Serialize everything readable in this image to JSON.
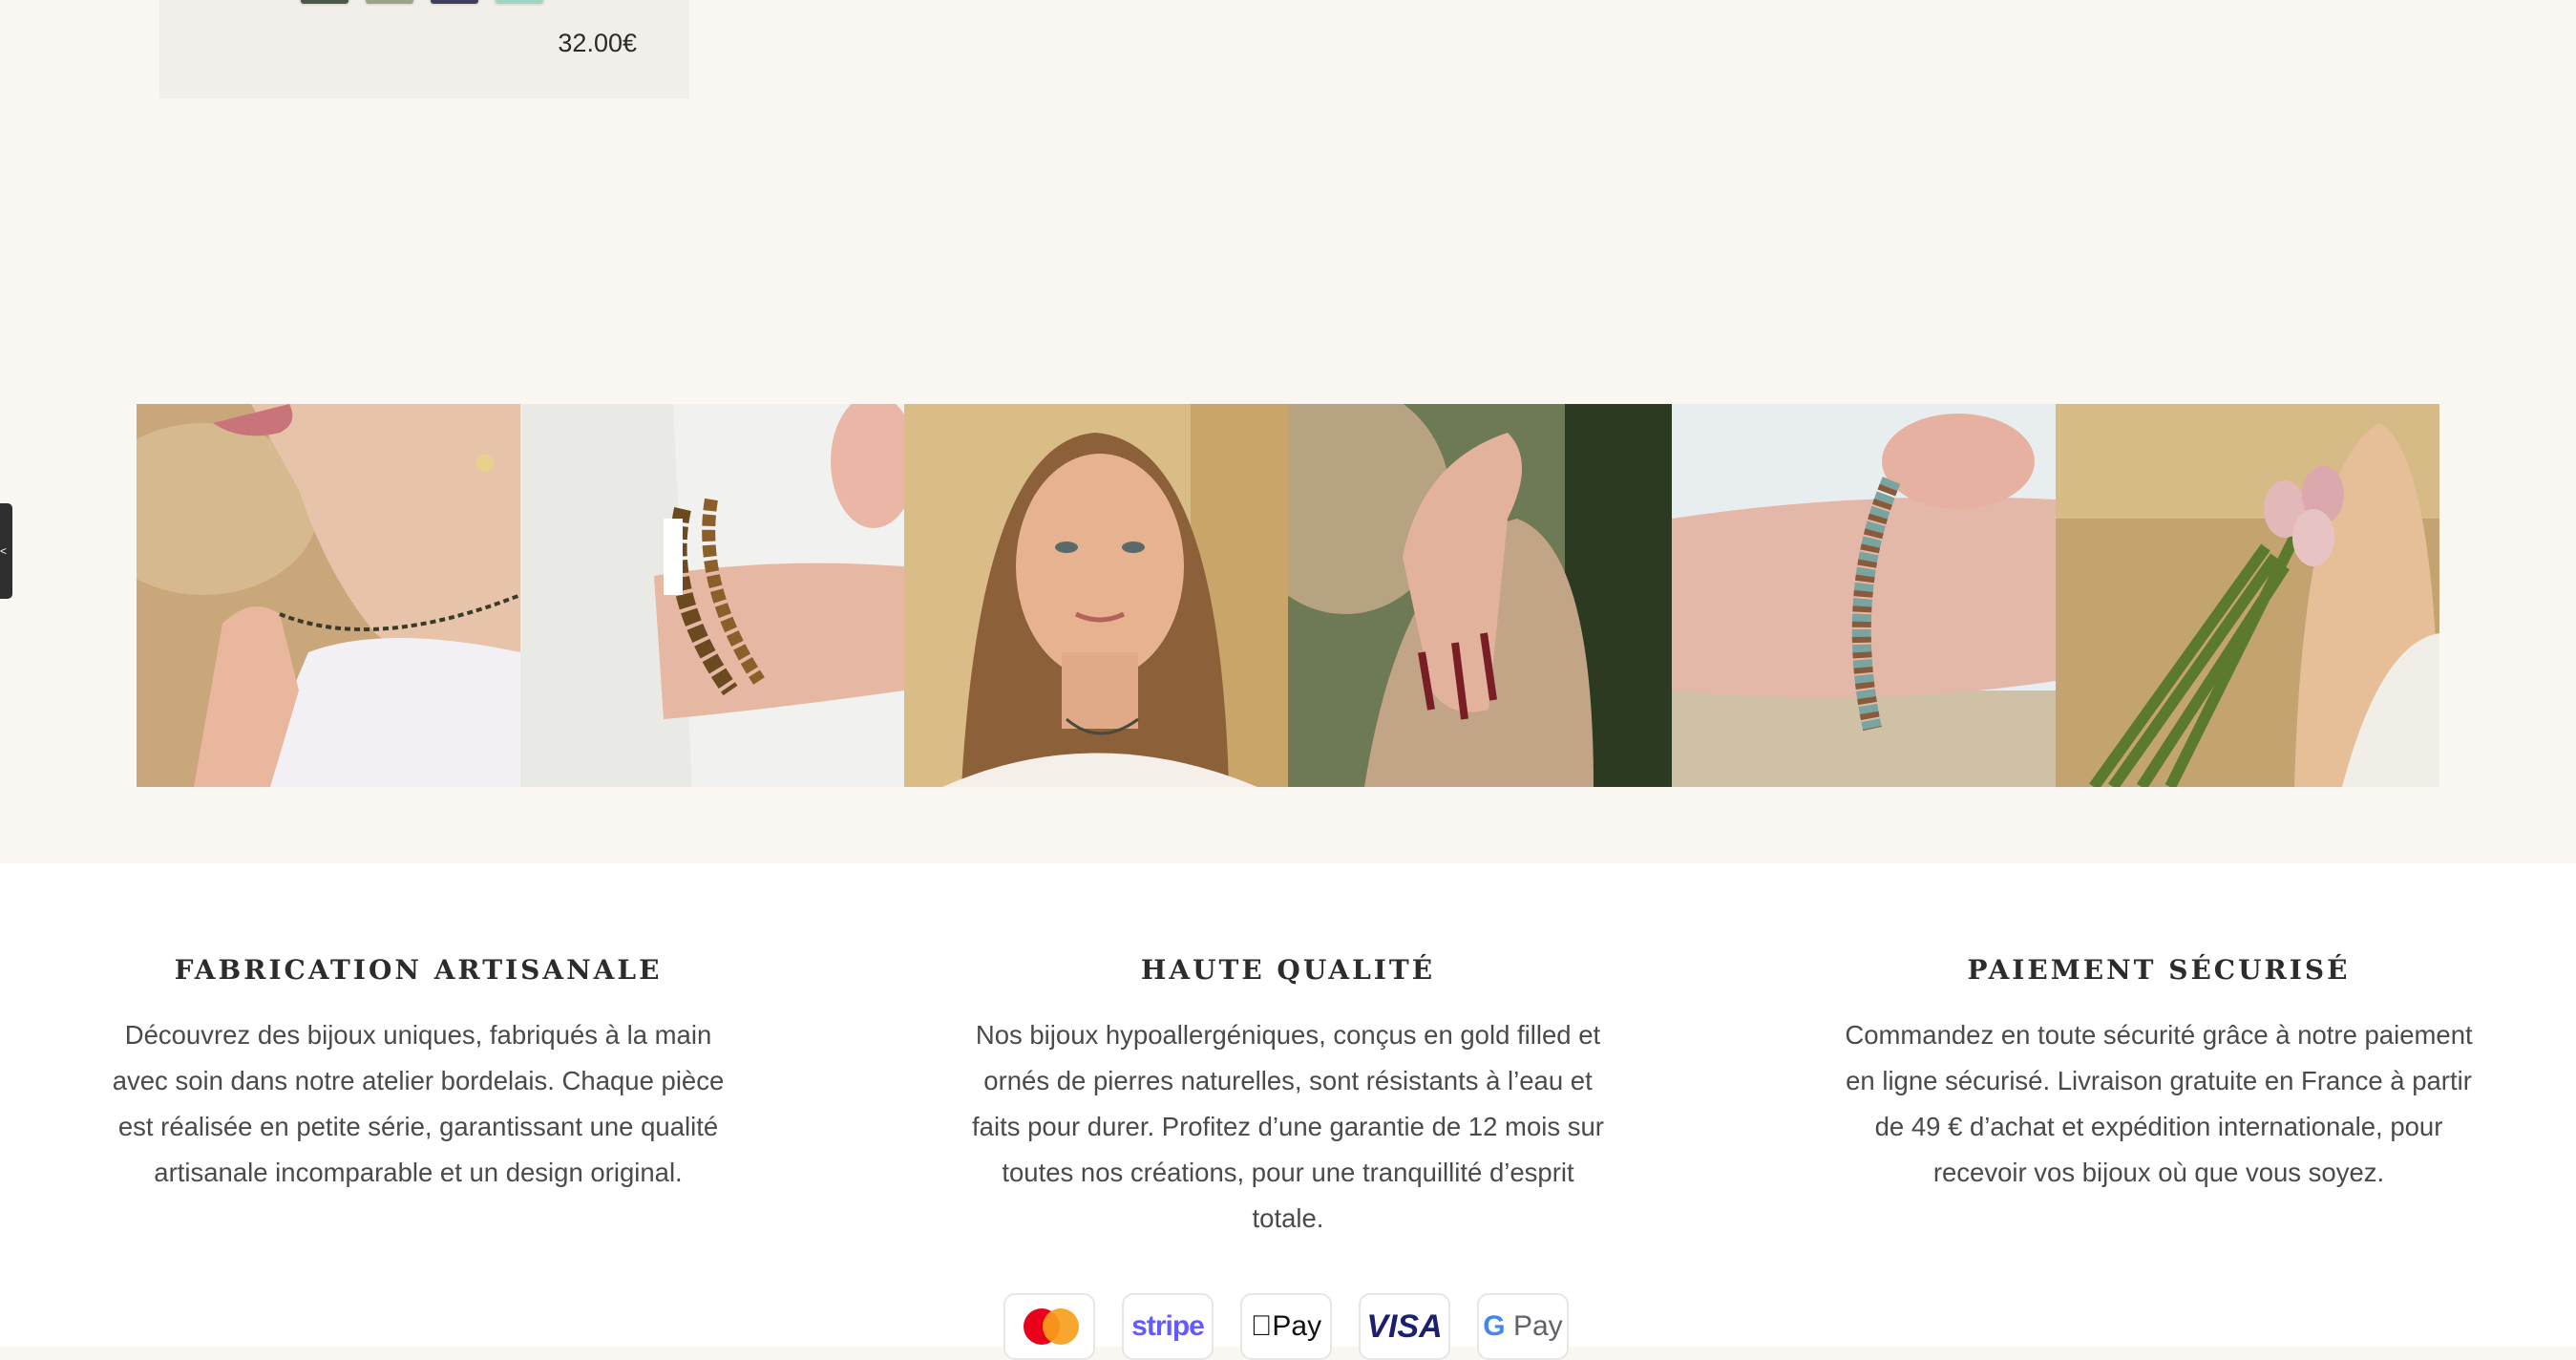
{
  "product": {
    "price": "32.00€",
    "swatch_colors": [
      "#4b5a48",
      "#9aa38c",
      "#3d3f5c",
      "#9fd5c4"
    ]
  },
  "side_tab": {
    "label": "<"
  },
  "gallery": {
    "photos": [
      {
        "icon": "necklace-photo"
      },
      {
        "icon": "tiger-eye-bracelet-photo"
      },
      {
        "icon": "portrait-necklace-photo"
      },
      {
        "icon": "rings-hand-photo"
      },
      {
        "icon": "stone-bracelet-photo"
      },
      {
        "icon": "tulips-woman-photo"
      }
    ]
  },
  "features": [
    {
      "title": "FABRICATION ARTISANALE",
      "text": "Découvrez des bijoux uniques, fabriqués à la main avec soin dans notre atelier bordelais. Chaque pièce est réalisée en petite série, garantissant une qualité artisanale incomparable et un design original."
    },
    {
      "title": "HAUTE QUALITÉ",
      "text": "Nos bijoux hypoallergéniques, conçus en gold filled et ornés de pierres naturelles, sont résistants à l’eau et faits pour durer. Profitez d’une garantie de 12 mois sur toutes nos créations, pour une tranquillité d’esprit totale."
    },
    {
      "title": "PAIEMENT SÉCURISÉ",
      "text": "Commandez en toute sécurité grâce à notre paiement en ligne sécurisé. Livraison gratuite en France à partir de 49 € d’achat et expédition internationale, pour recevoir vos bijoux où que vous soyez."
    }
  ],
  "payments": {
    "stripe": "stripe",
    "apple_pay": "Pay",
    "visa": "VISA",
    "google_pay_g": "G",
    "google_pay": "Pay"
  },
  "colors": {
    "background": "#faf6f2",
    "card": "#f2efeb",
    "footer_bg": "#ffffff",
    "heading": "#2c2c2c"
  }
}
